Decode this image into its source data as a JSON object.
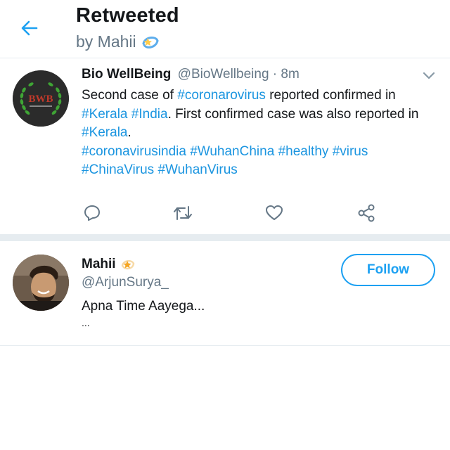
{
  "header": {
    "title": "Retweeted",
    "subtitle": "by Mahii",
    "back_icon": "back-arrow-icon",
    "accent": "#1da1f2"
  },
  "tweet": {
    "avatar_text": "BWB",
    "name": "Bio WellBeing",
    "handle": "@BioWellbeing",
    "separator": " · ",
    "time": "8m",
    "text_segments": [
      {
        "text": "Second case of ",
        "tag": false
      },
      {
        "text": "#coronarovirus",
        "tag": true
      },
      {
        "text": " reported confirmed in ",
        "tag": false
      },
      {
        "text": "#Kerala",
        "tag": true
      },
      {
        "text": " ",
        "tag": false
      },
      {
        "text": "#India",
        "tag": true
      },
      {
        "text": ". First confirmed case was also reported in ",
        "tag": false
      },
      {
        "text": "#Kerala",
        "tag": true
      },
      {
        "text": ".",
        "tag": false
      }
    ],
    "hashtags": [
      "#coronavirusindia",
      "#WuhanChina",
      "#healthy",
      "#virus",
      "#ChinaVirus",
      "#WuhanVirus"
    ],
    "actions": [
      "reply-icon",
      "retweet-icon",
      "like-icon",
      "share-icon"
    ],
    "tag_color": "#1b95e0"
  },
  "follow_card": {
    "name": "Mahii",
    "handle": "@ArjunSurya_",
    "bio": "Apna Time Aayega...",
    "more": "...",
    "follow_label": "Follow"
  }
}
